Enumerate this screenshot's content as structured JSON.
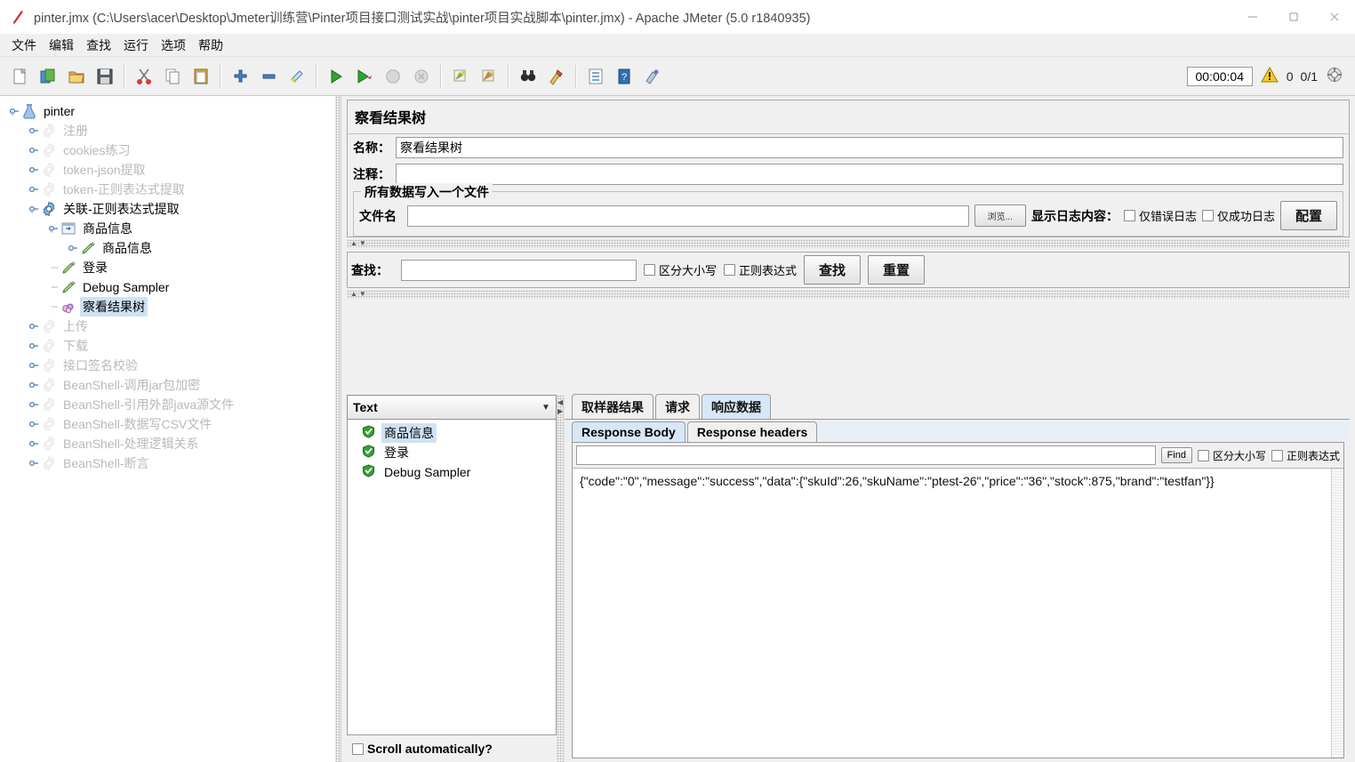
{
  "window": {
    "title": "pinter.jmx (C:\\Users\\acer\\Desktop\\Jmeter训练营\\Pinter项目接口测试实战\\pinter项目实战脚本\\pinter.jmx) - Apache JMeter (5.0 r1840935)",
    "app_icon": "jmeter-feather-icon",
    "minimize_label": "—",
    "maximize_label": "□",
    "close_label": "✕"
  },
  "menubar": {
    "items": [
      {
        "label": "文件",
        "name": "menu-file"
      },
      {
        "label": "编辑",
        "name": "menu-edit"
      },
      {
        "label": "查找",
        "name": "menu-search"
      },
      {
        "label": "运行",
        "name": "menu-run"
      },
      {
        "label": "选项",
        "name": "menu-options"
      },
      {
        "label": "帮助",
        "name": "menu-help"
      }
    ]
  },
  "toolbar": {
    "status": {
      "elapsed_time": "00:00:04",
      "warning_count": "0",
      "thread_count": "0/1"
    },
    "buttons": [
      {
        "name": "new-button",
        "icon": "new-document-icon"
      },
      {
        "name": "templates-button",
        "icon": "templates-icon"
      },
      {
        "name": "open-button",
        "icon": "open-folder-icon"
      },
      {
        "name": "save-button",
        "icon": "save-disk-icon"
      },
      {
        "name": "cut-button",
        "icon": "scissors-icon"
      },
      {
        "name": "copy-button",
        "icon": "copy-icon"
      },
      {
        "name": "paste-button",
        "icon": "clipboard-icon"
      },
      {
        "name": "expand-all-button",
        "icon": "plus-icon"
      },
      {
        "name": "collapse-all-button",
        "icon": "minus-icon"
      },
      {
        "name": "toggle-button",
        "icon": "toggle-icon"
      },
      {
        "name": "start-button",
        "icon": "play-green-icon"
      },
      {
        "name": "start-no-pauses-button",
        "icon": "play-fast-icon"
      },
      {
        "name": "stop-button",
        "icon": "stop-octagon-icon"
      },
      {
        "name": "shutdown-button",
        "icon": "shutdown-circle-icon"
      },
      {
        "name": "clear-button",
        "icon": "broom-clear-icon"
      },
      {
        "name": "clear-all-button",
        "icon": "broom-clear-all-icon"
      },
      {
        "name": "search-button",
        "icon": "binoculars-icon"
      },
      {
        "name": "reset-search-button",
        "icon": "reset-broom-icon"
      },
      {
        "name": "function-helper-button",
        "icon": "list-icon"
      },
      {
        "name": "help-button",
        "icon": "question-book-icon"
      },
      {
        "name": "undo-button",
        "icon": "undo-icon"
      }
    ]
  },
  "tree": {
    "items": [
      {
        "label": "pinter",
        "icon": "test-plan-icon",
        "depth": 0,
        "knob": "expanded",
        "state": "normal"
      },
      {
        "label": "注册",
        "icon": "thread-group-icon",
        "depth": 1,
        "knob": "collapsed",
        "state": "disabled"
      },
      {
        "label": "cookies练习",
        "icon": "thread-group-icon",
        "depth": 1,
        "knob": "collapsed",
        "state": "disabled"
      },
      {
        "label": "token-json提取",
        "icon": "thread-group-icon",
        "depth": 1,
        "knob": "collapsed",
        "state": "disabled"
      },
      {
        "label": "token-正则表达式提取",
        "icon": "thread-group-icon",
        "depth": 1,
        "knob": "collapsed",
        "state": "disabled"
      },
      {
        "label": "关联-正则表达式提取",
        "icon": "thread-group-active-icon",
        "depth": 1,
        "knob": "expanded",
        "state": "normal"
      },
      {
        "label": "商品信息",
        "icon": "transaction-controller-icon",
        "depth": 2,
        "knob": "expanded",
        "state": "normal"
      },
      {
        "label": "商品信息",
        "icon": "http-sampler-icon",
        "depth": 3,
        "knob": "collapsed",
        "state": "normal"
      },
      {
        "label": "登录",
        "icon": "http-sampler-icon",
        "depth": 2,
        "knob": "none",
        "state": "normal"
      },
      {
        "label": "Debug Sampler",
        "icon": "http-sampler-icon",
        "depth": 2,
        "knob": "none",
        "state": "normal"
      },
      {
        "label": "察看结果树",
        "icon": "view-results-tree-icon",
        "depth": 2,
        "knob": "none",
        "state": "selected"
      },
      {
        "label": "上传",
        "icon": "thread-group-icon",
        "depth": 1,
        "knob": "collapsed",
        "state": "disabled"
      },
      {
        "label": "下载",
        "icon": "thread-group-icon",
        "depth": 1,
        "knob": "collapsed",
        "state": "disabled"
      },
      {
        "label": "接口签名校验",
        "icon": "thread-group-icon",
        "depth": 1,
        "knob": "collapsed",
        "state": "disabled"
      },
      {
        "label": "BeanShell-调用jar包加密",
        "icon": "thread-group-icon",
        "depth": 1,
        "knob": "collapsed",
        "state": "disabled"
      },
      {
        "label": "BeanShell-引用外部java源文件",
        "icon": "thread-group-icon",
        "depth": 1,
        "knob": "collapsed",
        "state": "disabled"
      },
      {
        "label": "BeanShell-数据写CSV文件",
        "icon": "thread-group-icon",
        "depth": 1,
        "knob": "collapsed",
        "state": "disabled"
      },
      {
        "label": "BeanShell-处理逻辑关系",
        "icon": "thread-group-icon",
        "depth": 1,
        "knob": "collapsed",
        "state": "disabled"
      },
      {
        "label": "BeanShell-断言",
        "icon": "thread-group-icon",
        "depth": 1,
        "knob": "collapsed",
        "state": "disabled"
      }
    ]
  },
  "panel": {
    "title": "察看结果树",
    "name_label": "名称：",
    "name_value": "察看结果树",
    "comment_label": "注释：",
    "comment_value": "",
    "file_group_title": "所有数据写入一个文件",
    "filename_label": "文件名",
    "filename_value": "",
    "browse_button": "浏览...",
    "log_display_label": "显示日志内容：",
    "errors_only_label": "仅错误日志",
    "success_only_label": "仅成功日志",
    "configure_button": "配置"
  },
  "search": {
    "label": "查找：",
    "value": "",
    "case_sensitive_label": "区分大小写",
    "regex_label": "正则表达式",
    "find_button": "查找",
    "reset_button": "重置"
  },
  "results": {
    "renderer_selected": "Text",
    "scroll_auto_label": "Scroll automatically?",
    "entries": [
      {
        "label": "商品信息",
        "status": "success",
        "selected": true
      },
      {
        "label": "登录",
        "status": "success",
        "selected": false
      },
      {
        "label": "Debug Sampler",
        "status": "success",
        "selected": false
      }
    ],
    "tabs": [
      {
        "label": "取样器结果",
        "name": "tab-sampler-result",
        "active": false
      },
      {
        "label": "请求",
        "name": "tab-request",
        "active": false
      },
      {
        "label": "响应数据",
        "name": "tab-response-data",
        "active": true
      }
    ],
    "subtabs": [
      {
        "label": "Response Body",
        "name": "tab-response-body",
        "active": true
      },
      {
        "label": "Response headers",
        "name": "tab-response-headers",
        "active": false
      }
    ],
    "find": {
      "value": "",
      "button": "Find",
      "case_sensitive_label": "区分大小写",
      "regex_label": "正则表达式"
    },
    "response_body": "{\"code\":\"0\",\"message\":\"success\",\"data\":{\"skuId\":26,\"skuName\":\"ptest-26\",\"price\":\"36\",\"stock\":875,\"brand\":\"testfan\"}}"
  },
  "colors": {
    "selection": "#cfe2f3",
    "active_tab": "#d7e7f7",
    "panel_bg": "#f0f0f0",
    "success_green": "#35a035",
    "warning_yellow": "#ffcc00"
  }
}
